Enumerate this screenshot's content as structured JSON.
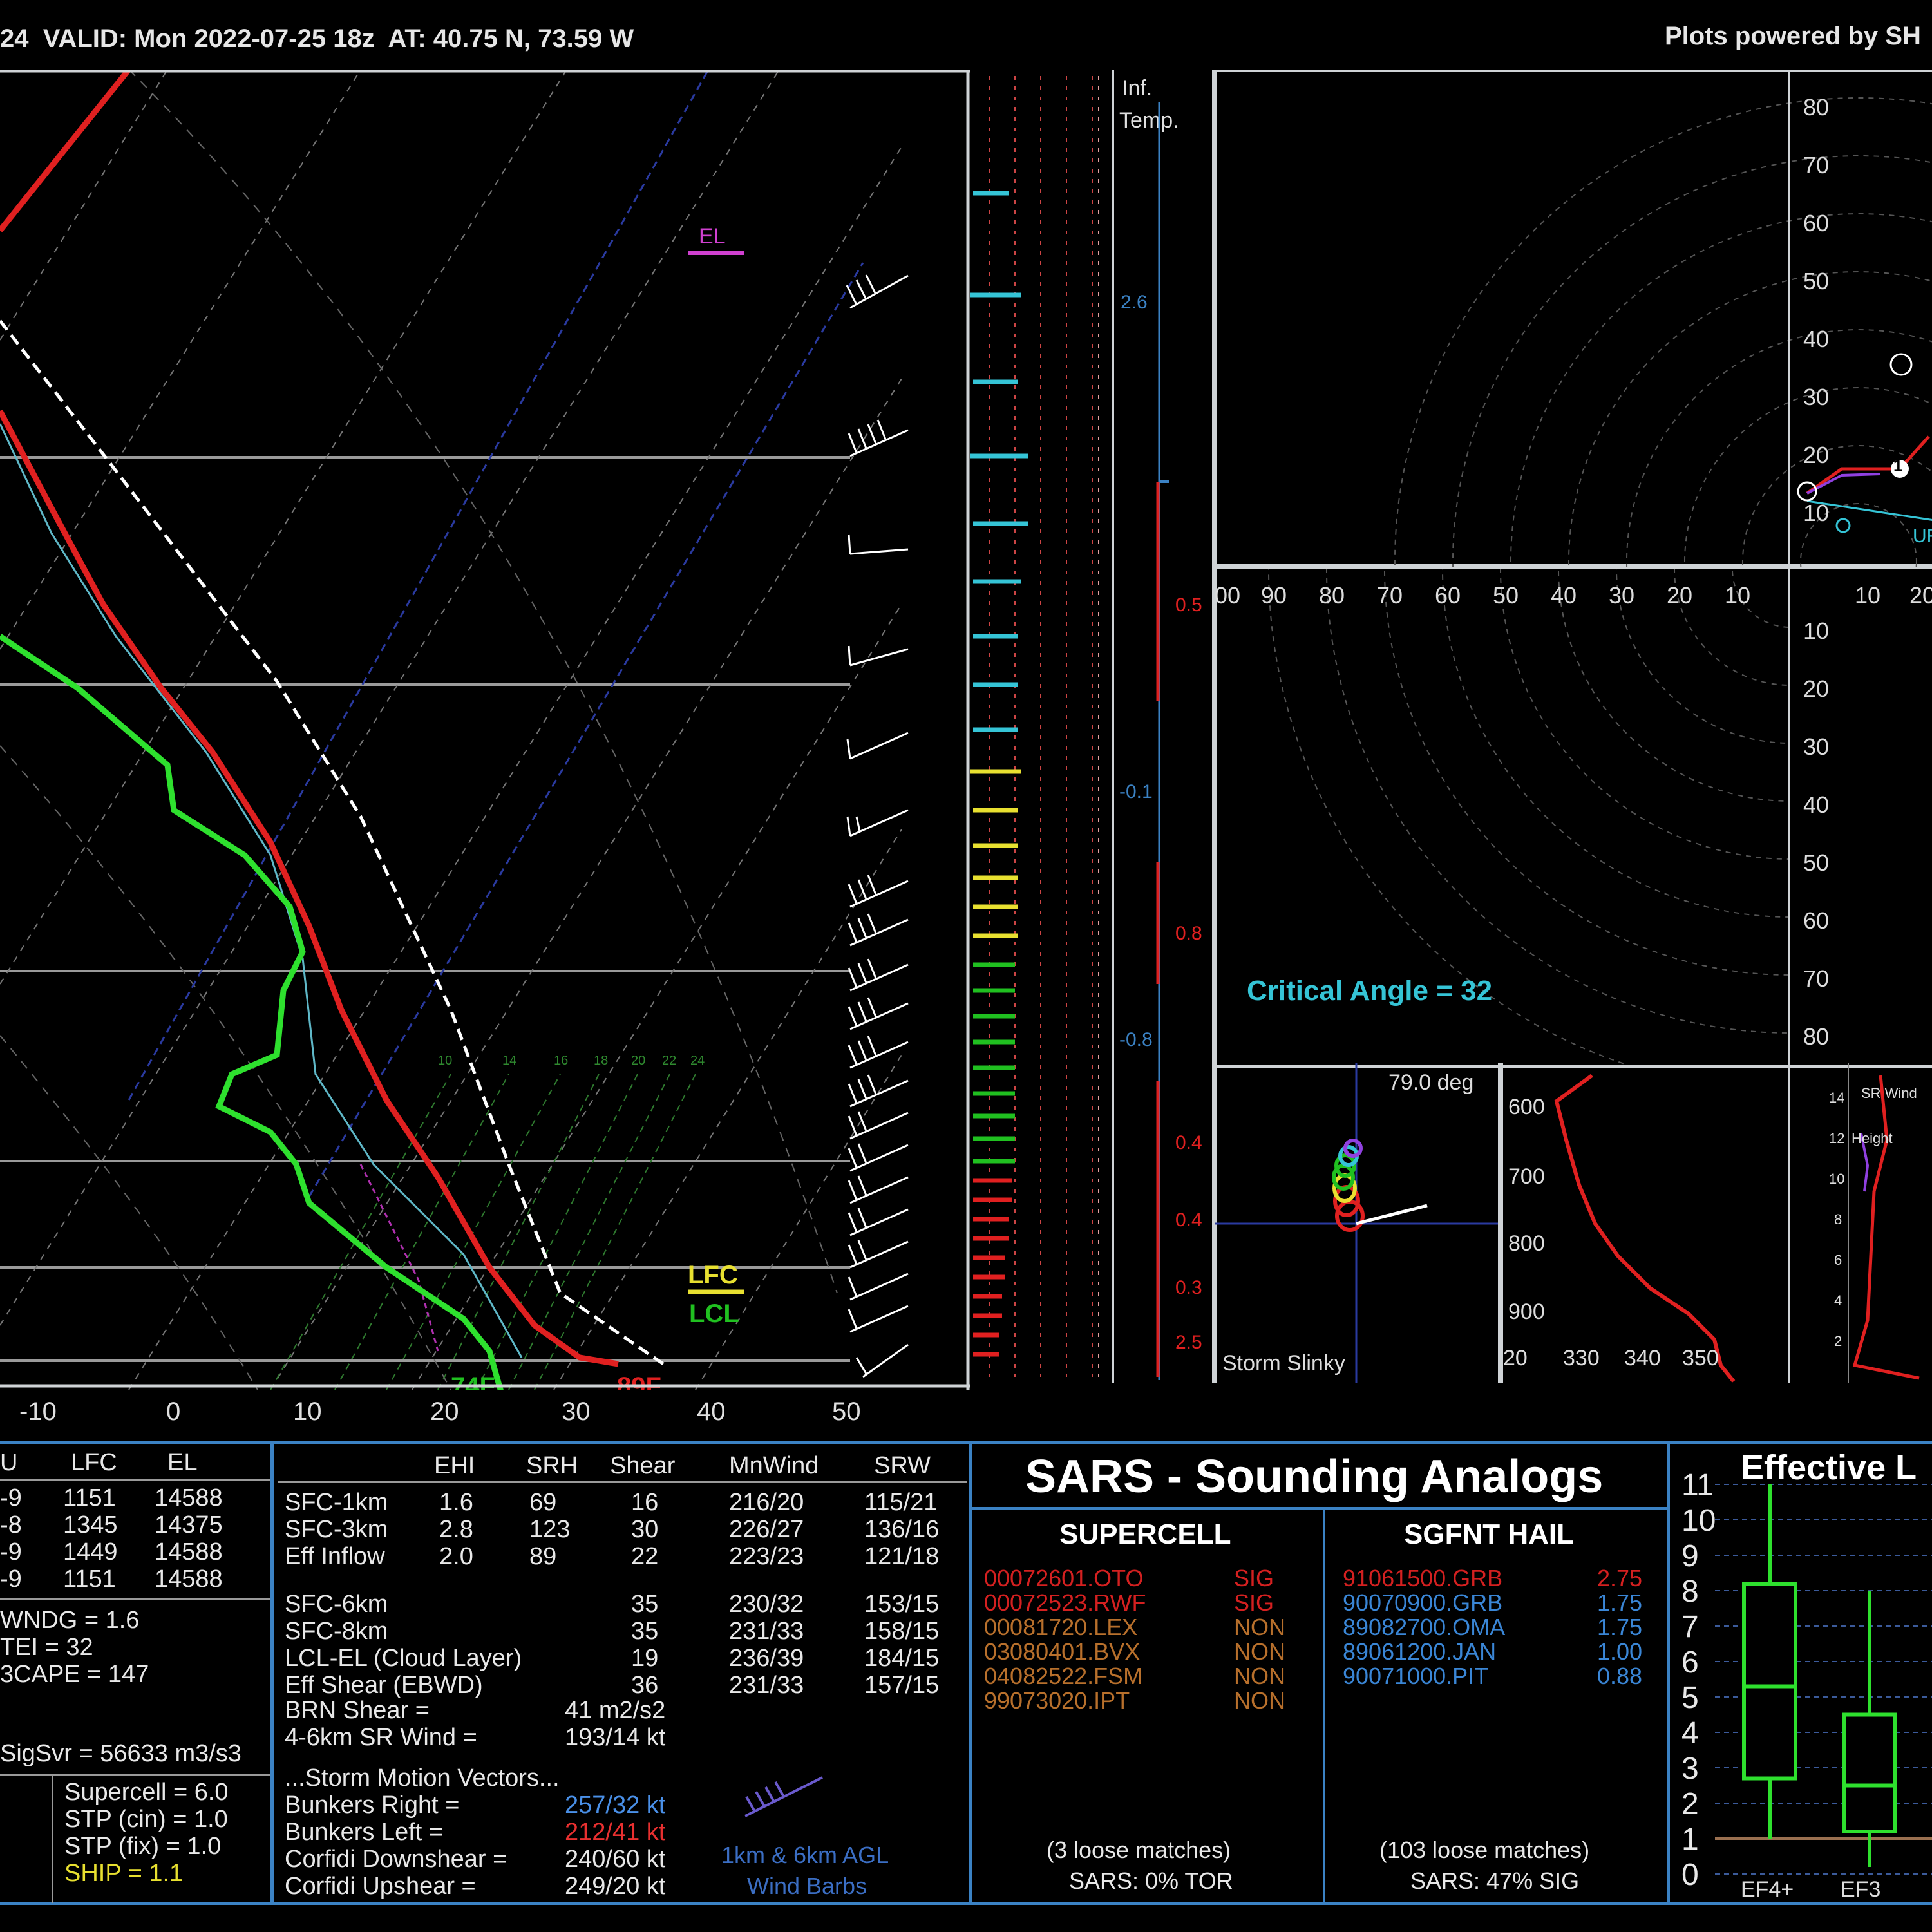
{
  "header": {
    "left": "24  VALID: Mon 2022-07-25 18z  AT: 40.75 N, 73.59 W",
    "right": "Plots powered by SH"
  },
  "skewt": {
    "x_ticks": [
      "-10",
      "0",
      "10",
      "20",
      "30",
      "40",
      "50"
    ],
    "labels": {
      "el": "EL",
      "lfc": "LFC",
      "lcl": "LCL",
      "dewpoint_sfc": "74F",
      "temp_sfc": "89F"
    },
    "mixing_ratio_labels": [
      "10",
      "14",
      "16",
      "18",
      "20",
      "22",
      "24"
    ]
  },
  "inflow_panel": {
    "labels": [
      "Inf.",
      "Temp."
    ],
    "values": [
      "2.6",
      "0.5",
      "-0.1",
      "0.8",
      "-0.8",
      "0.4",
      "0.4",
      "0.3",
      "2.5"
    ]
  },
  "hodograph": {
    "rings_right": [
      "80",
      "70",
      "60",
      "50",
      "40",
      "30",
      "20",
      "10"
    ],
    "markers": [
      "1",
      "2"
    ],
    "label_ur": "UR"
  },
  "polar": {
    "top_ticks": [
      "00",
      "90",
      "80",
      "70",
      "60",
      "50",
      "40",
      "30",
      "20",
      "10",
      "10",
      "20"
    ],
    "right_ticks": [
      "10",
      "20",
      "30",
      "40",
      "50",
      "60",
      "70",
      "80"
    ],
    "critical_angle": "Critical Angle = 32"
  },
  "slinky": {
    "angle": "79.0 deg",
    "label": "Storm Slinky"
  },
  "theta": {
    "y_ticks": [
      "600",
      "700",
      "800",
      "900"
    ],
    "x_ticks": [
      "20",
      "330",
      "340",
      "350"
    ]
  },
  "srwind": {
    "y_ticks": [
      "14",
      "12",
      "10",
      "8",
      "6",
      "4",
      "2"
    ],
    "labels": [
      "SR Wind",
      "Height"
    ]
  },
  "parcel_table": {
    "headers": [
      "U",
      "LFC",
      "EL"
    ],
    "rows": [
      [
        "-9",
        "1151",
        "14588"
      ],
      [
        "-8",
        "1345",
        "14375"
      ],
      [
        "-9",
        "1449",
        "14588"
      ],
      [
        "-9",
        "1151",
        "14588"
      ]
    ],
    "indices": [
      "WNDG = 1.6",
      "TEI = 32",
      "3CAPE = 147"
    ],
    "sigsvr": "SigSvr = 56633 m3/s3"
  },
  "composites": {
    "supercell": "Supercell = 6.0",
    "stp_cin": "STP (cin) = 1.0",
    "stp_fix": "STP (fix) = 1.0",
    "ship": "SHIP = 1.1"
  },
  "kinematics": {
    "headers": [
      "EHI",
      "SRH",
      "Shear",
      "MnWind",
      "SRW"
    ],
    "rows": [
      [
        "SFC-1km",
        "1.6",
        "69",
        "16",
        "216/20",
        "115/21"
      ],
      [
        "SFC-3km",
        "2.8",
        "123",
        "30",
        "226/27",
        "136/16"
      ],
      [
        "Eff Inflow",
        "2.0",
        "89",
        "22",
        "223/23",
        "121/18"
      ],
      [
        "SFC-6km",
        "",
        "",
        "35",
        "230/32",
        "153/15"
      ],
      [
        "SFC-8km",
        "",
        "",
        "35",
        "231/33",
        "158/15"
      ],
      [
        "LCL-EL (Cloud Layer)",
        "",
        "",
        "19",
        "236/39",
        "184/15"
      ],
      [
        "Eff Shear (EBWD)",
        "",
        "",
        "36",
        "231/33",
        "157/15"
      ]
    ],
    "brn_label": "BRN Shear =",
    "brn_value": "41 m2/s2",
    "srw_label": "4-6km SR Wind =",
    "srw_value": "193/14 kt",
    "motion_title": "...Storm Motion Vectors...",
    "motion": [
      {
        "label": "Bunkers Right =",
        "value": "257/32 kt",
        "color": "#4a90e8"
      },
      {
        "label": "Bunkers Left =",
        "value": "212/41 kt",
        "color": "#e83030"
      },
      {
        "label": "Corfidi Downshear =",
        "value": "240/60 kt",
        "color": "#e8e8e8"
      },
      {
        "label": "Corfidi Upshear =",
        "value": "249/20 kt",
        "color": "#e8e8e8"
      }
    ],
    "barb_caption_1": "1km & 6km AGL",
    "barb_caption_2": "Wind Barbs"
  },
  "sars": {
    "title": "SARS - Sounding Analogs",
    "supercell_title": "SUPERCELL",
    "hail_title": "SGFNT HAIL",
    "supercell": [
      {
        "id": "00072601.OTO",
        "cat": "SIG",
        "color": "#d42020"
      },
      {
        "id": "00072523.RWF",
        "cat": "SIG",
        "color": "#d42020"
      },
      {
        "id": "00081720.LEX",
        "cat": "NON",
        "color": "#b8702c"
      },
      {
        "id": "03080401.BVX",
        "cat": "NON",
        "color": "#b8702c"
      },
      {
        "id": "04082522.FSM",
        "cat": "NON",
        "color": "#b8702c"
      },
      {
        "id": "99073020.IPT",
        "cat": "NON",
        "color": "#b8702c"
      }
    ],
    "hail": [
      {
        "id": "91061500.GRB",
        "val": "2.75",
        "color": "#d42020"
      },
      {
        "id": "90070900.GRB",
        "val": "1.75",
        "color": "#3a86d6"
      },
      {
        "id": "89082700.OMA",
        "val": "1.75",
        "color": "#3a86d6"
      },
      {
        "id": "89061200.JAN",
        "val": "1.00",
        "color": "#3a86d6"
      },
      {
        "id": "90071000.PIT",
        "val": "0.88",
        "color": "#3a86d6"
      }
    ],
    "supercell_matches": "(3 loose matches)",
    "supercell_summary": "SARS: 0% TOR",
    "hail_matches": "(103 loose matches)",
    "hail_summary": "SARS: 47% SIG"
  },
  "boxplot": {
    "title": "Effective L",
    "y_ticks": [
      "0",
      "1",
      "2",
      "3",
      "4",
      "5",
      "6",
      "7",
      "8",
      "9",
      "10",
      "11"
    ],
    "categories": [
      "EF4+",
      "EF3"
    ]
  },
  "chart_data": [
    {
      "type": "line",
      "title": "",
      "note": "Skew-T log-P sounding",
      "xlabel": "",
      "ylabel": "",
      "x_ticks": [
        -10,
        0,
        10,
        20,
        30,
        40,
        50
      ],
      "series": []
    },
    {
      "type": "box",
      "title": "Effective L",
      "categories": [
        "EF4+",
        "EF3"
      ],
      "ylim": [
        0,
        11
      ],
      "boxes": [
        {
          "category": "EF4+",
          "whisker_low": 1,
          "q1": 2.7,
          "median": 5.3,
          "q3": 8.2,
          "whisker_high": 11
        },
        {
          "category": "EF3",
          "whisker_low": 0.2,
          "q1": 1.2,
          "median": 2.5,
          "q3": 4.5,
          "whisker_high": 8
        }
      ]
    }
  ],
  "colors": {
    "temp": "#e02020",
    "dew": "#2ee02e",
    "parcel": "#ffffff",
    "grid_blue": "#3b82c4",
    "cyan": "#35c4d6",
    "yellow": "#e8e030",
    "green": "#20c020",
    "magenta": "#d040d0"
  }
}
